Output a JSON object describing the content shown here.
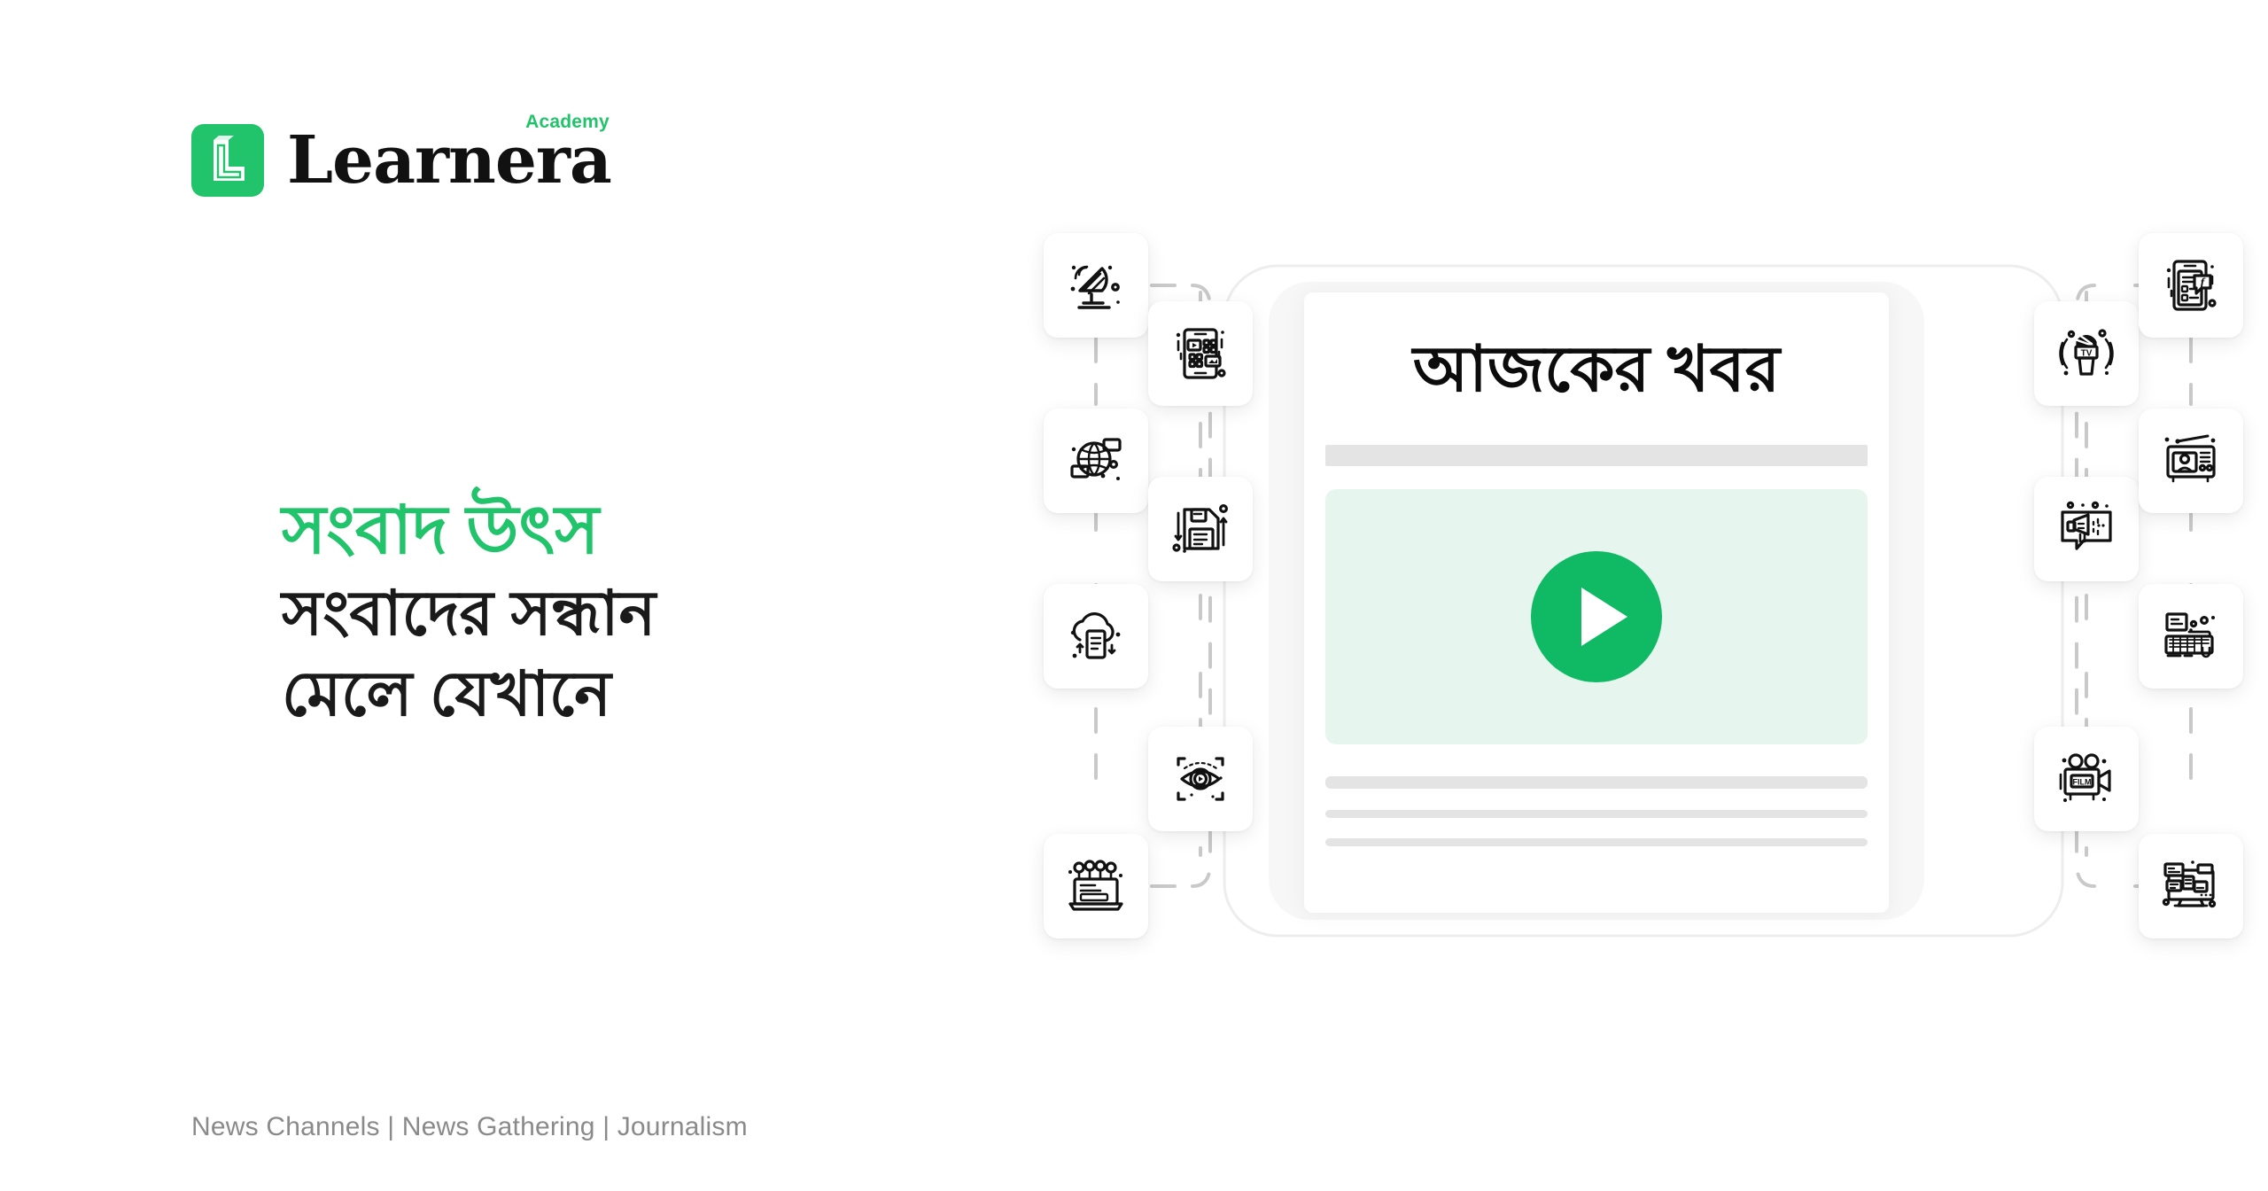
{
  "brand": {
    "name": "Learnera",
    "sub": "Academy",
    "logo_icon": "learnera-l-mark-icon",
    "green": "#21c36b"
  },
  "headline": {
    "eyebrow": "সংবাদ উৎস",
    "line1": "সংবাদের সন্ধান",
    "line2": "মেলে যেখানে",
    "eyebrow_color": "#21c36b",
    "body_color": "#1a1a1a"
  },
  "footer": {
    "tags": "News Channels | News Gathering | Journalism",
    "color": "#8a8a8a"
  },
  "news_card": {
    "headline": "আজকের খবর",
    "play_button_label": "play-button",
    "video_bg": "#e6f6ee",
    "play_color": "#10b964",
    "placeholder_color": "#e4e4e4"
  },
  "icons": {
    "left_outer": [
      {
        "name": "satellite-dish-icon",
        "label": "Satellite Dish"
      },
      {
        "name": "global-network-icon",
        "label": "Global Network"
      },
      {
        "name": "cloud-upload-document-icon",
        "label": "Cloud Upload"
      },
      {
        "name": "press-conference-laptop-icon",
        "label": "Press Conference"
      }
    ],
    "left_inner": [
      {
        "name": "tablet-video-app-icon",
        "label": "Tablet Video App"
      },
      {
        "name": "floppy-disk-save-icon",
        "label": "Save Archive"
      },
      {
        "name": "eye-play-scan-icon",
        "label": "Media Viewing"
      }
    ],
    "right_inner": [
      {
        "name": "tv-microphone-icon",
        "label": "TV Microphone"
      },
      {
        "name": "megaphone-announcement-icon",
        "label": "Announcement"
      },
      {
        "name": "film-camera-icon",
        "label": "Film Camera"
      }
    ],
    "right_outer": [
      {
        "name": "social-media-tablet-icon",
        "label": "Social Media"
      },
      {
        "name": "radio-broadcast-icon",
        "label": "Radio Broadcast"
      },
      {
        "name": "keyboard-typing-icon",
        "label": "Typing"
      },
      {
        "name": "desktop-news-layout-icon",
        "label": "Online News"
      }
    ]
  }
}
